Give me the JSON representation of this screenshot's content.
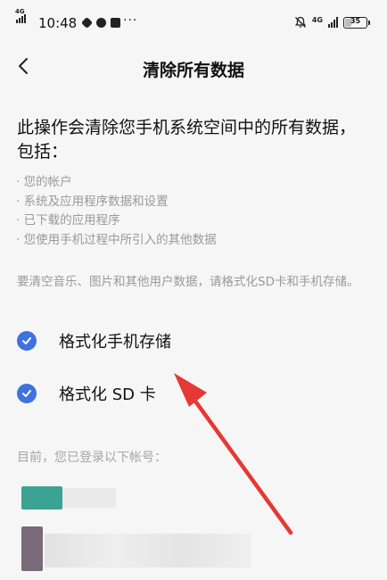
{
  "status_bar": {
    "network_left": "4G",
    "time": "10:48",
    "overflow": "···",
    "network_right": "4G",
    "battery_level": "35",
    "battery_fraction": 0.35
  },
  "header": {
    "title": "清除所有数据",
    "back_icon": "chevron-left-icon"
  },
  "intro": "此操作会清除您手机系统空间中的所有数据，包括：",
  "bullets": [
    "您的帐户",
    "系统及应用程序数据和设置",
    "已下载的应用程序",
    "您使用手机过程中所引入的其他数据"
  ],
  "note": "要清空音乐、图片和其他用户数据，请格式化SD卡和手机存储。",
  "options": [
    {
      "label": "格式化手机存储",
      "checked": true
    },
    {
      "label": "格式化 SD 卡",
      "checked": true
    }
  ],
  "accounts_label": "目前，您已登录以下帐号：",
  "colors": {
    "accent": "#3f72e0",
    "arrow": "#e53935",
    "background": "#f6f6f6",
    "muted_text": "#9a9a9a"
  }
}
